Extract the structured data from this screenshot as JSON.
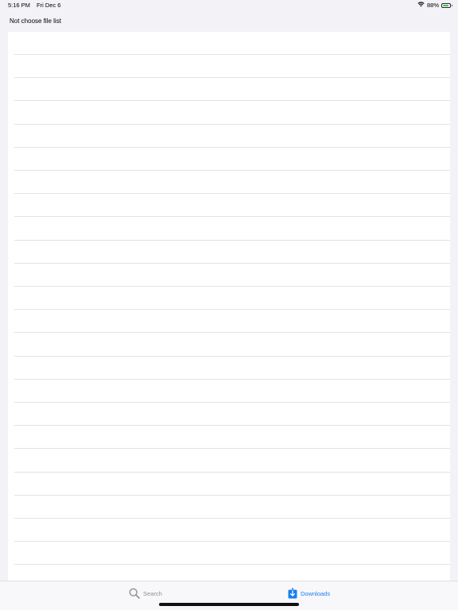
{
  "status_bar": {
    "time": "5:16 PM",
    "date": "Fri Dec 6",
    "battery": "88%",
    "icons": [
      "wifi-icon",
      "battery-icon"
    ]
  },
  "header": {
    "title": "Not choose file list"
  },
  "list": {
    "rows": 24
  },
  "tab_bar": {
    "tabs": [
      {
        "label": "Search",
        "icon": "search-icon",
        "selected": false
      },
      {
        "label": "Downloads",
        "icon": "download-icon",
        "selected": true
      }
    ]
  },
  "colors": {
    "accent": "#1a7ef0",
    "background": "#f2f2f7",
    "inactive": "#8e8e93"
  }
}
